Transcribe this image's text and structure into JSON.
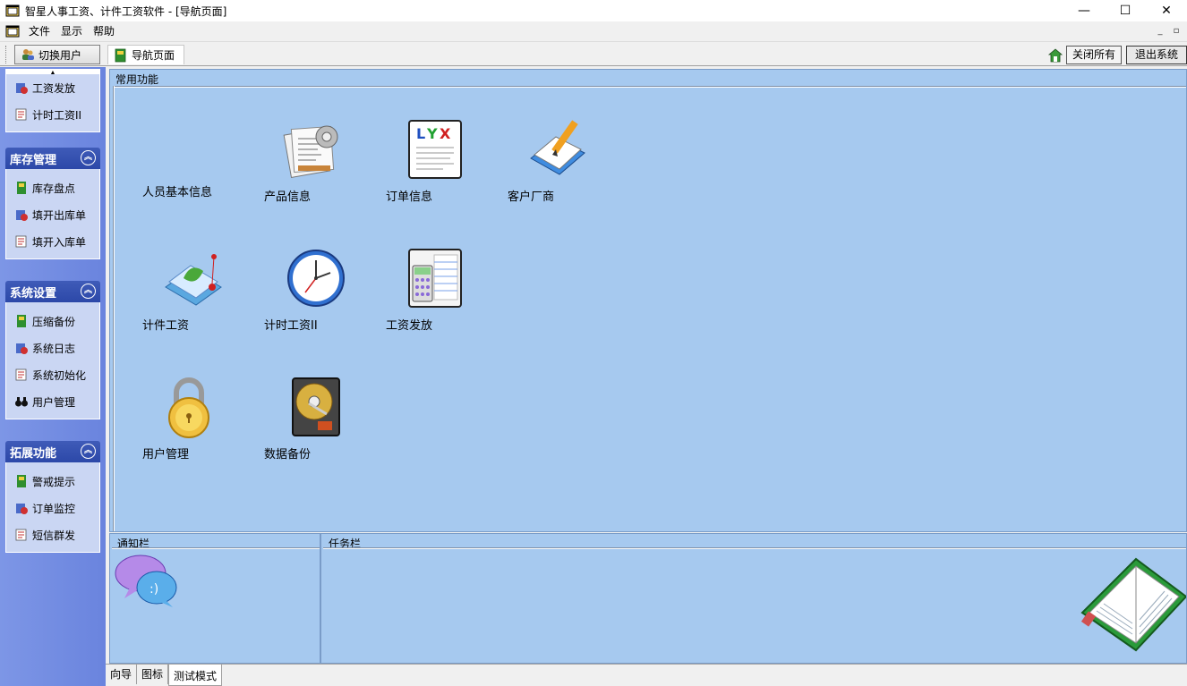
{
  "window": {
    "title": "智星人事工资、计件工资软件 - [导航页面]"
  },
  "menu": {
    "items": [
      "文件",
      "显示",
      "帮助"
    ]
  },
  "toolbar": {
    "switch_user": "切换用户",
    "nav_page": "导航页面",
    "close_all": "关闭所有",
    "exit": "退出系统"
  },
  "sidebar": {
    "top_group_items": [
      "工资发放",
      "计时工资II"
    ],
    "groups": [
      {
        "title": "库存管理",
        "items": [
          "库存盘点",
          "填开出库单",
          "填开入库单"
        ]
      },
      {
        "title": "系统设置",
        "items": [
          "压缩备份",
          "系统日志",
          "系统初始化",
          "用户管理"
        ]
      },
      {
        "title": "拓展功能",
        "items": [
          "警戒提示",
          "订单监控",
          "短信群发"
        ]
      }
    ]
  },
  "main": {
    "group_label": "常用功能",
    "functions": [
      {
        "label": "人员基本信息",
        "icon": "none"
      },
      {
        "label": "产品信息",
        "icon": "documents-gear-icon"
      },
      {
        "label": "订单信息",
        "icon": "lyx-document-icon"
      },
      {
        "label": "客户厂商",
        "icon": "pencil-paper-icon"
      },
      {
        "label": "计件工资",
        "icon": "leaf-notebook-icon"
      },
      {
        "label": "计时工资II",
        "icon": "clock-icon"
      },
      {
        "label": "工资发放",
        "icon": "calculator-icon"
      },
      {
        "label": "用户管理",
        "icon": "padlock-icon"
      },
      {
        "label": "数据备份",
        "icon": "hard-disk-icon"
      }
    ]
  },
  "notify": {
    "label": "通知栏"
  },
  "tasks": {
    "label": "任务栏"
  },
  "bottom_tabs": [
    "向导",
    "图标",
    "测试模式"
  ],
  "colors": {
    "panel_bg": "#a6c9ef",
    "sidebar_bg": "#6a84de",
    "group_header": "#2c48a8"
  }
}
